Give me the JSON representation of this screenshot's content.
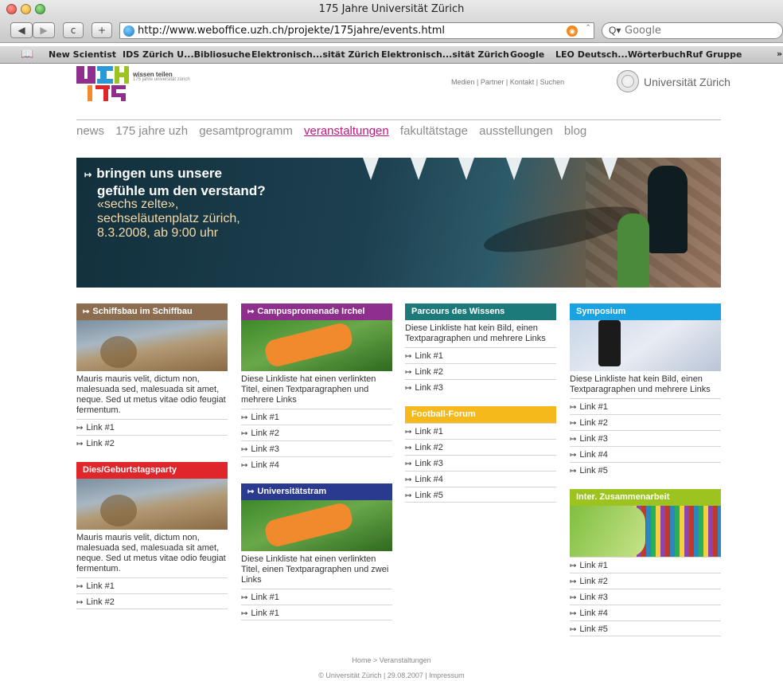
{
  "window": {
    "title": "175 Jahre Universität Zürich"
  },
  "toolbar": {
    "back": "◀",
    "forward": "▶",
    "reload": "c",
    "add": "+"
  },
  "address": {
    "url": "http://www.weboffice.uzh.ch/projekte/175jahre/events.html"
  },
  "search": {
    "placeholder": "Google"
  },
  "bookmarks": [
    "New Scientist",
    "IDS Zürich U...Bibliosuche",
    "Elektronisch...sität Zürich",
    "Elektronisch...sität Zürich",
    "Google",
    "LEO Deutsch...Wörterbuch",
    "Ruf Gruppe"
  ],
  "bookmarks_more": "»",
  "logo": {
    "tag1": "wissen teilen",
    "tag2": "175 jahre universität zürich"
  },
  "toplinks": [
    "Medien",
    "Partner",
    "Kontakt",
    "Suchen"
  ],
  "university": "Universität Zürich",
  "nav": [
    "news",
    "175 jahre uzh",
    "gesamtprogramm",
    "veranstaltungen",
    "fakultätstage",
    "ausstellungen",
    "blog"
  ],
  "nav_active": "veranstaltungen",
  "banner": {
    "line1": "bringen uns unsere",
    "line2": "gefühle um den verstand?",
    "line3": "«sechs zelte»,",
    "line4": "sechseläutenplatz zürich,",
    "line5": "8.3.2008, ab 9:00 uhr"
  },
  "colors": {
    "brown": "#8c6d4f",
    "purple": "#8e2f8e",
    "teal": "#1d7a7a",
    "cyan": "#1aa3e0",
    "red": "#e0262a",
    "navy": "#2a3a8f",
    "yellow": "#f5b91c",
    "green": "#9cc31f",
    "accent": "#c8127f"
  },
  "col1": {
    "box1": {
      "title": "Schiffsbau im Schiffbau",
      "text": "Mauris mauris velit, dictum non, malesuada sed, malesuada sit amet, neque. Sed ut metus vitae odio feugiat fermentum.",
      "links": [
        "Link #1",
        "Link #2"
      ]
    },
    "box2": {
      "title": "Dies/Geburtstagsparty",
      "text": "Mauris mauris velit, dictum non, malesuada sed, malesuada sit amet, neque. Sed ut metus vitae odio feugiat fermentum.",
      "links": [
        "Link #1",
        "Link #2"
      ]
    }
  },
  "col2": {
    "box1": {
      "title": "Campuspromenade Irchel",
      "text": "Diese Linkliste hat einen verlinkten Titel, einen Textparagraphen und mehrere Links",
      "links": [
        "Link #1",
        "Link #2",
        "Link #3",
        "Link #4"
      ]
    },
    "box2": {
      "title": "Universitätstram",
      "text": "Diese Linkliste hat einen verlinkten Titel, einen Textparagraphen und zwei Links",
      "links": [
        "Link #1",
        "Link #1"
      ]
    }
  },
  "col3": {
    "box1": {
      "title": "Parcours des Wissens",
      "text": "Diese Linkliste hat kein Bild, einen Textparagraphen und mehrere Links",
      "links": [
        "Link #1",
        "Link #2",
        "Link #3"
      ]
    },
    "box2": {
      "title": "Football-Forum",
      "links": [
        "Link #1",
        "Link #2",
        "Link #3",
        "Link #4",
        "Link #5"
      ]
    }
  },
  "col4": {
    "box1": {
      "title": "Symposium",
      "text": "Diese Linkliste hat kein Bild, einen Textparagraphen und mehrere Links",
      "links": [
        "Link #1",
        "Link #2",
        "Link #3",
        "Link #4",
        "Link #5"
      ]
    },
    "box2": {
      "title": "Inter. Zusammenarbeit",
      "links": [
        "Link #1",
        "Link #2",
        "Link #3",
        "Link #4",
        "Link #5"
      ]
    }
  },
  "link_arrow": "↦",
  "footer": {
    "breadcrumb": "Home > Veranstaltungen",
    "copyright": "© Universität Zürich | 29.08.2007 | Impressum"
  }
}
